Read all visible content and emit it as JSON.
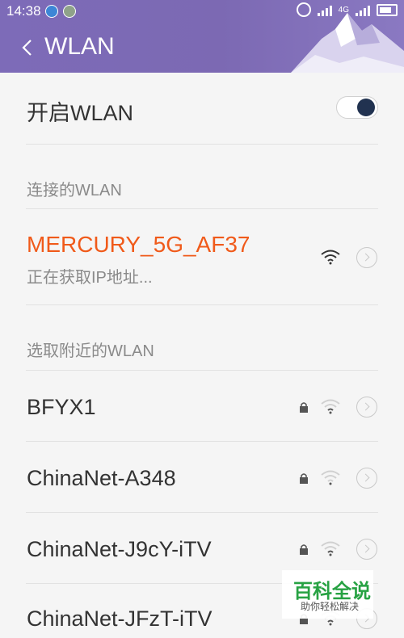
{
  "status": {
    "time": "14:38",
    "network": "4G"
  },
  "header": {
    "title": "WLAN"
  },
  "toggle": {
    "label": "开启WLAN",
    "on": true
  },
  "connected": {
    "section": "连接的WLAN",
    "name": "MERCURY_5G_AF37",
    "status": "正在获取IP地址..."
  },
  "nearby": {
    "section": "选取附近的WLAN",
    "networks": [
      {
        "name": "BFYX1",
        "secured": true
      },
      {
        "name": "ChinaNet-A348",
        "secured": true
      },
      {
        "name": "ChinaNet-J9cY-iTV",
        "secured": true
      },
      {
        "name": "ChinaNet-JFzT-iTV",
        "secured": true
      }
    ]
  },
  "watermark": {
    "title": "百科全说",
    "subtitle": "助你轻松解决"
  },
  "colors": {
    "header": "#7d6bb8",
    "connected_text": "#f05a1a",
    "toggle_knob": "#213250"
  }
}
